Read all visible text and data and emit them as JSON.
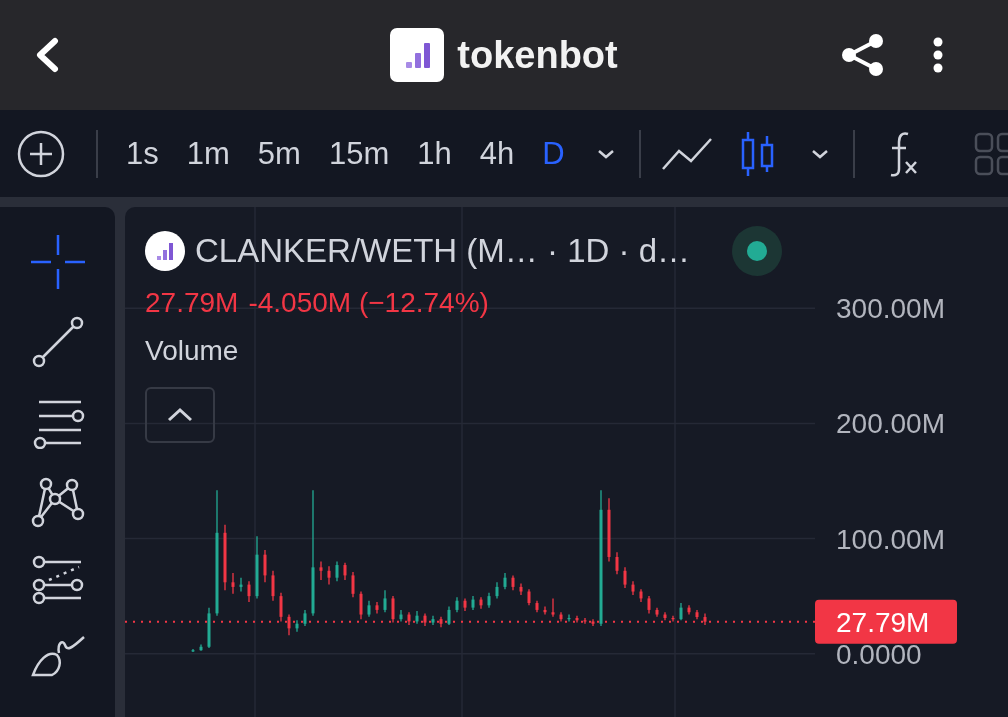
{
  "app_bar": {
    "title": "tokenbot"
  },
  "toolbar": {
    "intervals": [
      {
        "label": "1s",
        "selected": false
      },
      {
        "label": "1m",
        "selected": false
      },
      {
        "label": "5m",
        "selected": false
      },
      {
        "label": "15m",
        "selected": false
      },
      {
        "label": "1h",
        "selected": false
      },
      {
        "label": "4h",
        "selected": false
      },
      {
        "label": "D",
        "selected": true
      }
    ],
    "chart_types": [
      {
        "kind": "line",
        "selected": false
      },
      {
        "kind": "candles",
        "selected": true
      }
    ]
  },
  "drawing_tools": [
    {
      "kind": "crosshair",
      "selected": true
    },
    {
      "kind": "trend-line",
      "selected": false
    },
    {
      "kind": "level-lines",
      "selected": false
    },
    {
      "kind": "pattern",
      "selected": false
    },
    {
      "kind": "projection",
      "selected": false
    },
    {
      "kind": "brush",
      "selected": false
    }
  ],
  "chart": {
    "symbol": "CLANKER/WETH (M… · 1D · d…",
    "live": true,
    "last_value": "27.79M",
    "change": "-4.050M (−12.74%)",
    "indicator": "Volume",
    "chart_data": [
      {
        "type": "candlestick",
        "ylim": [
          -55,
          388
        ],
        "yticks": [
          {
            "value": 0,
            "label": "0.0000"
          },
          {
            "value": 100,
            "label": "100.00M"
          },
          {
            "value": 200,
            "label": "200.00M"
          },
          {
            "value": 300,
            "label": "300.00M"
          }
        ],
        "grid": true,
        "ohlc": [
          [
            2,
            4,
            1.5,
            3
          ],
          [
            3,
            8,
            2.5,
            6
          ],
          [
            6,
            40,
            5,
            35
          ],
          [
            35,
            142,
            33,
            105
          ],
          [
            105,
            112,
            55,
            62
          ],
          [
            62,
            70,
            52,
            58
          ],
          [
            58,
            66,
            54,
            60
          ],
          [
            60,
            63,
            45,
            50
          ],
          [
            50,
            102,
            48,
            86
          ],
          [
            86,
            90,
            62,
            68
          ],
          [
            68,
            72,
            46,
            50
          ],
          [
            50,
            53,
            28,
            32
          ],
          [
            32,
            34,
            16,
            22
          ],
          [
            22,
            29,
            19,
            26
          ],
          [
            26,
            38,
            24,
            35
          ],
          [
            35,
            142,
            33,
            75
          ],
          [
            75,
            80,
            64,
            72
          ],
          [
            72,
            76,
            60,
            66
          ],
          [
            66,
            80,
            63,
            77
          ],
          [
            77,
            79,
            64,
            68
          ],
          [
            68,
            71,
            49,
            52
          ],
          [
            52,
            54,
            30,
            34
          ],
          [
            34,
            46,
            32,
            42
          ],
          [
            42,
            45,
            35,
            38
          ],
          [
            38,
            55,
            36,
            48
          ],
          [
            48,
            50,
            27,
            30
          ],
          [
            30,
            38,
            28,
            34
          ],
          [
            34,
            36,
            25,
            28
          ],
          [
            28,
            37,
            26,
            33
          ],
          [
            33,
            35,
            24,
            27
          ],
          [
            27,
            33,
            25,
            30
          ],
          [
            30,
            32,
            23,
            26
          ],
          [
            26,
            41,
            25,
            38
          ],
          [
            38,
            49,
            36,
            46
          ],
          [
            46,
            48,
            37,
            40
          ],
          [
            40,
            50,
            38,
            47
          ],
          [
            47,
            49,
            39,
            42
          ],
          [
            42,
            53,
            40,
            50
          ],
          [
            50,
            62,
            48,
            58
          ],
          [
            58,
            70,
            56,
            66
          ],
          [
            66,
            68,
            55,
            58
          ],
          [
            58,
            61,
            51,
            54
          ],
          [
            54,
            56,
            42,
            44
          ],
          [
            44,
            46,
            36,
            38
          ],
          [
            38,
            41,
            34,
            36
          ],
          [
            36,
            48,
            32,
            34
          ],
          [
            34,
            36,
            28,
            30
          ],
          [
            30,
            34,
            28,
            31
          ],
          [
            31,
            33,
            27,
            29
          ],
          [
            29,
            31,
            26,
            28
          ],
          [
            28,
            30,
            24,
            26
          ],
          [
            26,
            142,
            24,
            125
          ],
          [
            125,
            135,
            80,
            84
          ],
          [
            84,
            88,
            69,
            72
          ],
          [
            72,
            75,
            57,
            60
          ],
          [
            60,
            63,
            51,
            54
          ],
          [
            54,
            56,
            45,
            48
          ],
          [
            48,
            50,
            35,
            38
          ],
          [
            38,
            40,
            32,
            34
          ],
          [
            34,
            36,
            29,
            31
          ],
          [
            31,
            33,
            28,
            30
          ],
          [
            30,
            44,
            29,
            40
          ],
          [
            40,
            42,
            34,
            36
          ],
          [
            36,
            38,
            30,
            31.84
          ],
          [
            31.84,
            35,
            25,
            27.79
          ]
        ],
        "ref_lines": [
          {
            "axis": "y",
            "value": 27.79,
            "label": "27.79M",
            "color": "#f23645",
            "line_style": "dotted"
          }
        ]
      }
    ]
  }
}
